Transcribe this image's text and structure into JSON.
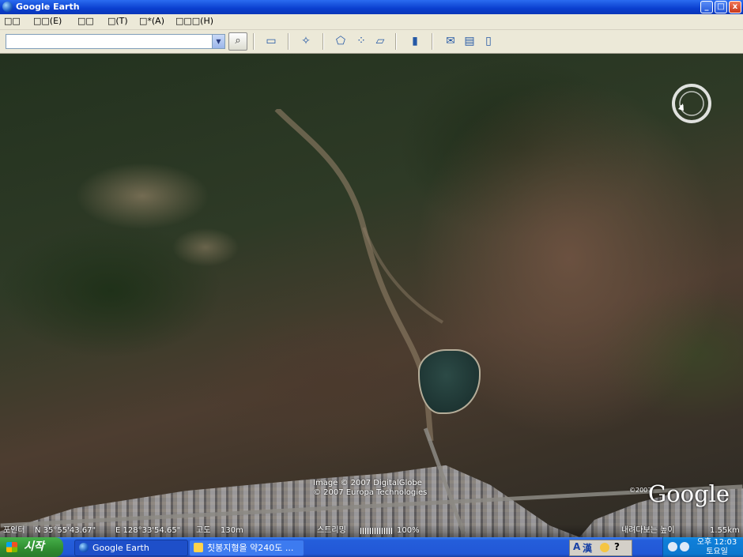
{
  "window": {
    "title": "Google Earth",
    "min": "_",
    "max": "□",
    "close": "x"
  },
  "menu": [
    "□□",
    "□□(E)",
    "□□",
    "□(T)",
    "□*(A)",
    "□□□(H)"
  ],
  "search": {
    "value": "",
    "placeholder": ""
  },
  "toolbar_icons": [
    "sidebar-toggle-icon",
    "placemark-add-icon",
    "polygon-add-icon",
    "path-add-icon",
    "overlay-add-icon",
    "ruler-icon",
    "email-icon",
    "print-icon",
    "maps-view-icon"
  ],
  "map": {
    "copyright_1": "Image © 2007 DigitalGlobe",
    "copyright_2": "© 2007 Europa Technologies",
    "logo_year": "©2007",
    "logo": "Google",
    "compass_letter": "N"
  },
  "status": {
    "pointer_label": "포인터",
    "lat": "N 35°55'43.67\"",
    "lon": "E 128°33'54.65\"",
    "elev_label": "고도",
    "elev": "130m",
    "streaming_label": "스트리밍",
    "streaming_pct": "100%",
    "view_label": "내려다보는 높이",
    "eye_alt": "1.55km"
  },
  "taskbar": {
    "start": "시작",
    "task1": "Google Earth",
    "task2": "칫봉지형을 약240도 ...",
    "lang_1": "A",
    "lang_2": "漢",
    "clock_1": "오후 12:03",
    "clock_2": "토요일"
  },
  "colors": {
    "titlebar": "#0a3fcf",
    "taskbar": "#245edb",
    "start": "#2f8c30"
  }
}
